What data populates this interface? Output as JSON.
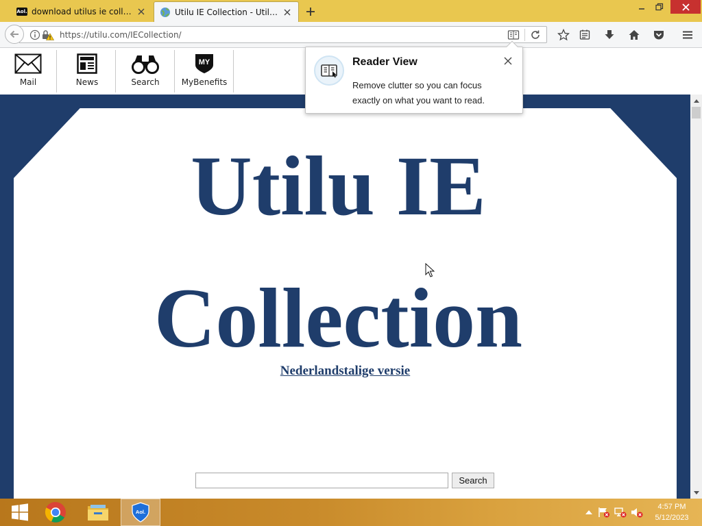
{
  "tabs": [
    {
      "title": "download utilus ie collecti...",
      "icon": "aol-icon",
      "icon_text": "Aol."
    },
    {
      "title": "Utilu IE Collection - Utilu.c...",
      "icon": "globe-icon"
    }
  ],
  "window_controls": {
    "minimize": "minimize-icon",
    "maximize": "maximize-icon",
    "close": "close-icon"
  },
  "address_bar": {
    "url": "https://utilu.com/IECollection/"
  },
  "aol_toolbar": {
    "items": [
      {
        "label": "Mail",
        "icon": "mail-envelope-icon"
      },
      {
        "label": "News",
        "icon": "newspaper-icon"
      },
      {
        "label": "Search",
        "icon": "binoculars-icon"
      },
      {
        "label": "MyBenefits",
        "icon": "mybenefits-shield-icon",
        "icon_text": "MY"
      }
    ]
  },
  "reader_popup": {
    "title": "Reader View",
    "body": "Remove clutter so you can focus exactly on what you want to read."
  },
  "page": {
    "heading_line1": "Utilu IE",
    "heading_line2": "Collection",
    "language_link": "Nederlandstalige versie",
    "search_input_value": "",
    "search_button": "Search",
    "colors": {
      "brand_navy": "#1f3d6b",
      "background": "#ffffff"
    }
  },
  "taskbar": {
    "apps": [
      "start-windows-icon",
      "chrome-icon",
      "file-explorer-icon",
      "aol-shield-icon"
    ],
    "aol_shield_text": "Aol.",
    "clock_time": "4:57 PM",
    "clock_date": "5/12/2023"
  },
  "theme": {
    "titlebar": "#e9c74f",
    "close_button": "#c7312f",
    "taskbar": "#c98b2b"
  }
}
